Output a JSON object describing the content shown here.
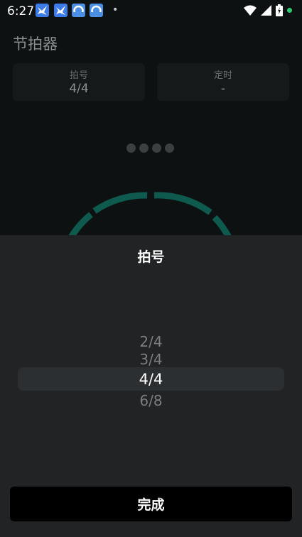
{
  "status_bar": {
    "time": "6:27",
    "dot": "•",
    "colors": {
      "bird": "#3d7be8",
      "app": "#4a8ee6",
      "battery_dot": "#2ecc71"
    }
  },
  "header": {
    "title": "节拍器"
  },
  "cards": [
    {
      "label": "拍号",
      "value": "4/4"
    },
    {
      "label": "定时",
      "value": "-"
    }
  ],
  "beats": {
    "count": 4
  },
  "dial": {
    "color": "#0e5a4e"
  },
  "sheet": {
    "title": "拍号",
    "options": [
      "2/4",
      "3/4",
      "4/4",
      "6/8"
    ],
    "selected": "4/4",
    "done_label": "完成"
  }
}
